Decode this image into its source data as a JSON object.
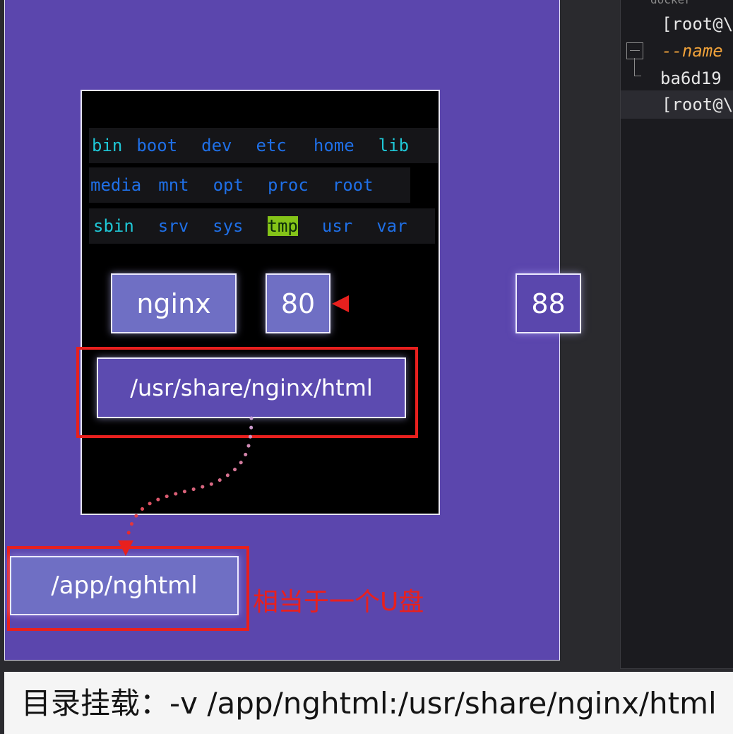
{
  "container": {
    "dir_rows": [
      [
        {
          "text": "bin",
          "color": "cyan"
        },
        {
          "text": "boot",
          "color": "blue"
        },
        {
          "text": "dev",
          "color": "blue"
        },
        {
          "text": "etc",
          "color": "blue"
        },
        {
          "text": "home",
          "color": "blue"
        },
        {
          "text": "lib",
          "color": "cyan"
        }
      ],
      [
        {
          "text": "media",
          "color": "blue"
        },
        {
          "text": "mnt",
          "color": "blue"
        },
        {
          "text": "opt",
          "color": "blue"
        },
        {
          "text": "proc",
          "color": "blue"
        },
        {
          "text": "root",
          "color": "blue"
        }
      ],
      [
        {
          "text": "sbin",
          "color": "cyan"
        },
        {
          "text": "srv",
          "color": "blue"
        },
        {
          "text": "sys",
          "color": "blue"
        },
        {
          "text": "tmp",
          "color": "tmp"
        },
        {
          "text": "usr",
          "color": "blue"
        },
        {
          "text": "var",
          "color": "blue"
        }
      ]
    ],
    "app_label": "nginx",
    "container_port": "80",
    "container_path": "/usr/share/nginx/html"
  },
  "host": {
    "host_port": "88",
    "host_path": "/app/nghtml",
    "note": "相当于一个U盘"
  },
  "terminal": {
    "lines": [
      "[root@\\",
      "--name",
      "ba6d19",
      "[root@\\"
    ],
    "top_fragment": "docker"
  },
  "caption": "目录挂载：-v /app/nghtml:/usr/share/nginx/html",
  "colors": {
    "host_bg": "#5b46ad",
    "highlight": "#e8201e",
    "arrow_red": "#e8201e",
    "arrow_lavender": "#c9a3d8",
    "dir_cyan": "#1fc7d6",
    "dir_blue": "#1f6fe6",
    "tmp_bg": "#84c318"
  }
}
